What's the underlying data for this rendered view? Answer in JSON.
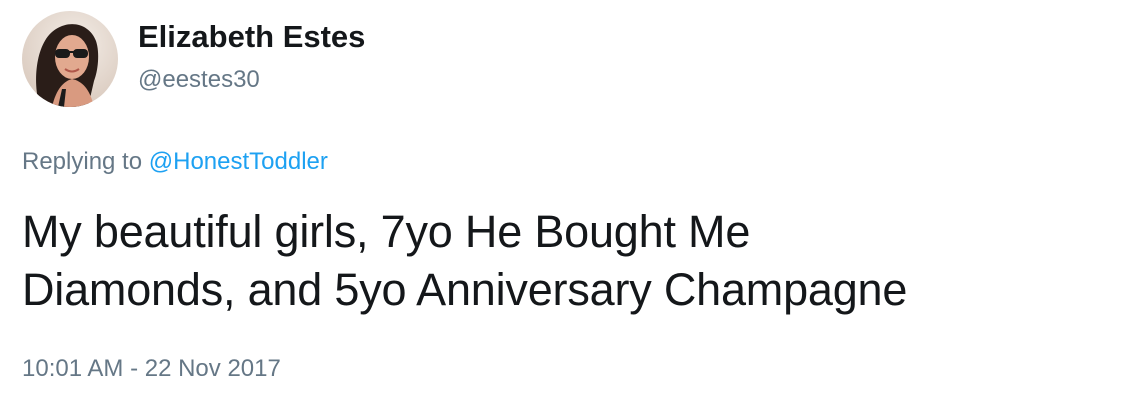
{
  "author": {
    "display_name": "Elizabeth Estes",
    "handle": "@eestes30"
  },
  "reply": {
    "prefix": "Replying to",
    "mention": "@HonestToddler"
  },
  "tweet": {
    "text_line1": "My beautiful girls, 7yo He Bought Me",
    "text_line2": "Diamonds, and 5yo Anniversary Champagne",
    "timestamp": "10:01 AM - 22 Nov 2017"
  },
  "colors": {
    "name": "#14171a",
    "secondary": "#657786",
    "link": "#1da1f2"
  }
}
